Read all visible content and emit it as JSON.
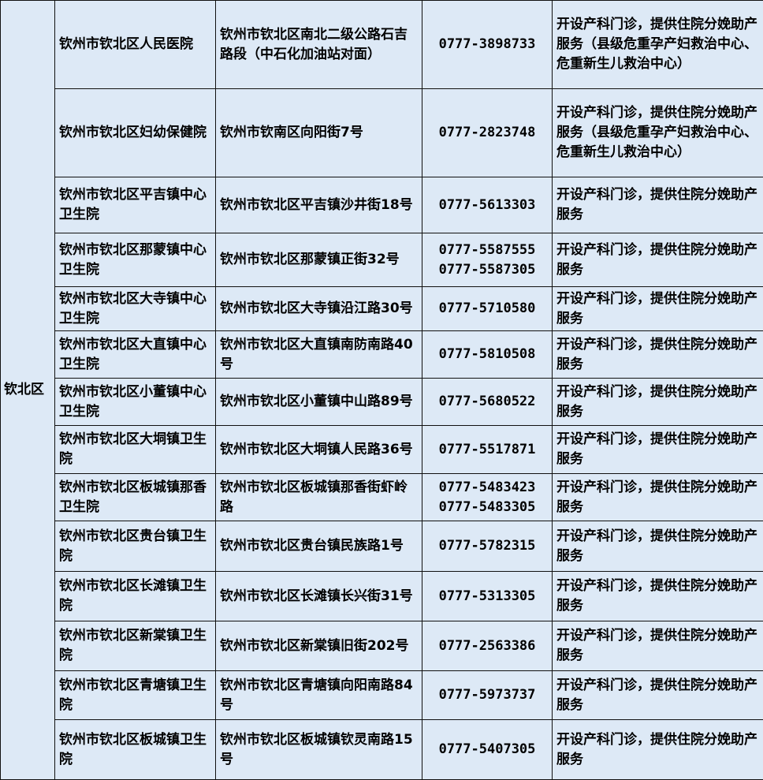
{
  "district": "钦北区",
  "rows": [
    {
      "name": "钦州市钦北区人民医院",
      "address": "钦州市钦北区南北二级公路石吉路段（中石化加油站对面）",
      "phones": [
        "0777-3898733"
      ],
      "service": "开设产科门诊，提供住院分娩助产服务（县级危重孕产妇救治中心、危重新生儿救治中心）"
    },
    {
      "name": "钦州市钦北区妇幼保健院",
      "address": "钦州市钦南区向阳街7号",
      "phones": [
        "0777-2823748"
      ],
      "service": "开设产科门诊，提供住院分娩助产服务（县级危重孕产妇救治中心、危重新生儿救治中心）"
    },
    {
      "name": "钦州市钦北区平吉镇中心卫生院",
      "address": "钦州市钦北区平吉镇沙井街18号",
      "phones": [
        "0777-5613303"
      ],
      "service": "开设产科门诊，提供住院分娩助产服务"
    },
    {
      "name": "钦州市钦北区那蒙镇中心卫生院",
      "address": "钦州市钦北区那蒙镇正街32号",
      "phones": [
        "0777-5587555",
        "0777-5587305"
      ],
      "service": "开设产科门诊，提供住院分娩助产服务"
    },
    {
      "name": "钦州市钦北区大寺镇中心卫生院",
      "address": "钦州市钦北区大寺镇沿江路30号",
      "phones": [
        "0777-5710580"
      ],
      "service": "开设产科门诊，提供住院分娩助产服务"
    },
    {
      "name": "钦州市钦北区大直镇中心卫生院",
      "address": "钦州市钦北区大直镇南防南路40号",
      "phones": [
        "0777-5810508"
      ],
      "service": "开设产科门诊，提供住院分娩助产服务"
    },
    {
      "name": "钦州市钦北区小董镇中心卫生院",
      "address": "钦州市钦北区小董镇中山路89号",
      "phones": [
        "0777-5680522"
      ],
      "service": "开设产科门诊，提供住院分娩助产服务"
    },
    {
      "name": "钦州市钦北区大垌镇卫生院",
      "address": "钦州市钦北区大垌镇人民路36号",
      "phones": [
        "0777-5517871"
      ],
      "service": "开设产科门诊，提供住院分娩助产服务"
    },
    {
      "name": "钦州市钦北区板城镇那香卫生院",
      "address": "钦州市钦北区板城镇那香街虾岭路",
      "phones": [
        "0777-5483423",
        "0777-5483305"
      ],
      "service": "开设产科门诊，提供住院分娩助产服务"
    },
    {
      "name": "钦州市钦北区贵台镇卫生院",
      "address": "钦州市钦北区贵台镇民族路1号",
      "phones": [
        "0777-5782315"
      ],
      "service": "开设产科门诊，提供住院分娩助产服务"
    },
    {
      "name": "钦州市钦北区长滩镇卫生院",
      "address": "钦州市钦北区长滩镇长兴街31号",
      "phones": [
        "0777-5313305"
      ],
      "service": "开设产科门诊，提供住院分娩助产服务"
    },
    {
      "name": "钦州市钦北区新棠镇卫生院",
      "address": "钦州市钦北区新棠镇旧街202号",
      "phones": [
        "0777-2563386"
      ],
      "service": "开设产科门诊，提供住院分娩助产服务"
    },
    {
      "name": "钦州市钦北区青塘镇卫生院",
      "address": "钦州市钦北区青塘镇向阳南路84号",
      "phones": [
        "0777-5973737"
      ],
      "service": "开设产科门诊，提供住院分娩助产服务"
    },
    {
      "name": "钦州市钦北区板城镇卫生院",
      "address": "钦州市钦北区板城镇钦灵南路15号",
      "phones": [
        "0777-5407305"
      ],
      "service": "开设产科门诊，提供住院分娩助产服务"
    }
  ]
}
